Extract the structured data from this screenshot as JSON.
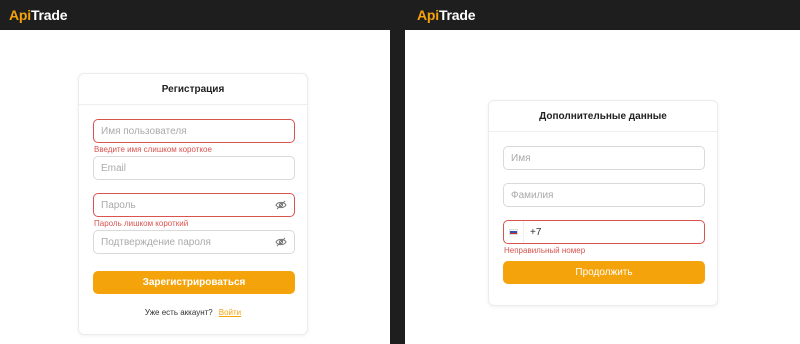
{
  "brand": {
    "part1": "Api",
    "part2": "Trade"
  },
  "registration": {
    "title": "Регистрация",
    "username": {
      "placeholder": "Имя пользователя",
      "value": "",
      "error": "Введите имя слишком короткое"
    },
    "email": {
      "placeholder": "Email",
      "value": ""
    },
    "password": {
      "placeholder": "Пароль",
      "value": "",
      "error": "Пароль лишком короткий"
    },
    "confirm": {
      "placeholder": "Подтверждение пароля",
      "value": ""
    },
    "submit_label": "Зарегистрироваться",
    "have_account": "Уже есть аккаунт?",
    "login_link": "Войти"
  },
  "additional": {
    "title": "Дополнительные данные",
    "first_name": {
      "placeholder": "Имя",
      "value": ""
    },
    "last_name": {
      "placeholder": "Фамилия",
      "value": ""
    },
    "phone": {
      "value": "+7",
      "country_flag": "russia-flag-icon",
      "error": "Неправильный номер"
    },
    "continue_label": "Продолжить"
  },
  "colors": {
    "accent": "#f5a30a",
    "error": "#d9534f",
    "topbar": "#1e1e1e"
  }
}
